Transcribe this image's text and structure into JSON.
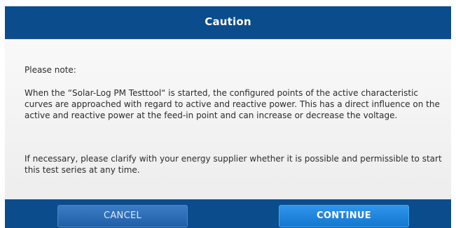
{
  "dialog": {
    "title": "Caution",
    "note_label": "Please note:",
    "paragraph1": "When the “Solar-Log PM Testtool“ is started, the configured points of the active characteristic curves are approached with regard to active and reactive power. This has a direct influence on the active and reactive power at the feed-in point and can increase or decrease the voltage.",
    "paragraph2": "If necessary, please clarify with your energy supplier whether it is possible and permissible to start this test series at any time.",
    "cancel_label": "CANCEL",
    "continue_label": "CONTINUE"
  },
  "colors": {
    "header_background": "#0b4c8c",
    "body_background": "#f3f3f3",
    "continue_button": "#1e88e5",
    "cancel_button": "#2a6bb5"
  }
}
